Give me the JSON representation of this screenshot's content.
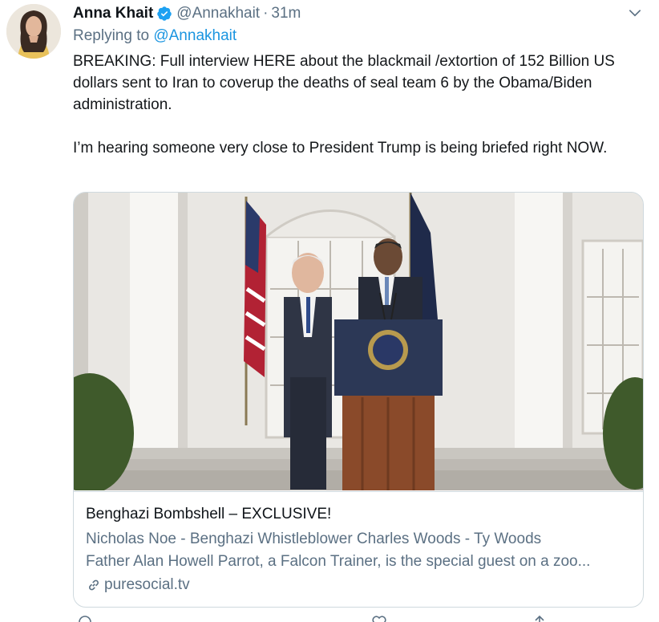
{
  "tweet": {
    "author_name": "Anna Khait",
    "handle": "@Annakhait",
    "separator": "·",
    "time_ago": "31m",
    "replying_prefix": "Replying to",
    "replying_handle": "@Annakhait",
    "paragraph_1": "BREAKING: Full interview HERE about the blackmail /extortion of 152 Billion US dollars sent to Iran to coverup the deaths of seal team 6 by the Obama/Biden administration.",
    "paragraph_2": "I’m hearing someone very close to President Trump is being briefed right NOW."
  },
  "card": {
    "title": "Benghazi Bombshell – EXCLUSIVE!",
    "description_line_1": "Nicholas Noe - Benghazi Whistleblower Charles Woods - Ty Woods",
    "description_line_2": "Father Alan Howell Parrot, a Falcon Trainer, is the special guest on a zoo...",
    "domain": "puresocial.tv"
  },
  "icons": {
    "verified": "verified-badge-icon",
    "caret": "chevron-down-icon",
    "link": "link-icon"
  },
  "colors": {
    "link_blue": "#1b95e0",
    "secondary_text": "#5b7083",
    "verified_blue": "#1da1f2",
    "border": "#cfd9de"
  }
}
